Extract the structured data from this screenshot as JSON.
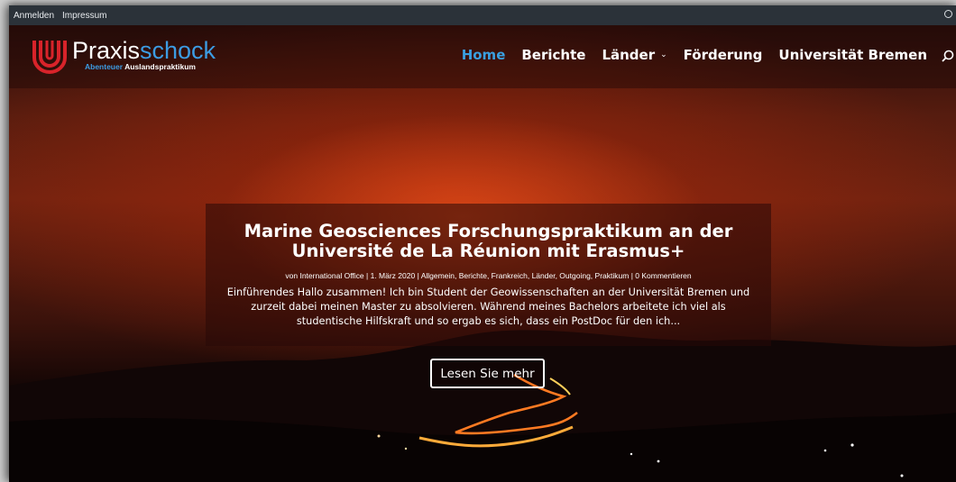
{
  "topbar": {
    "links": [
      "Anmelden",
      "Impressum"
    ]
  },
  "logo": {
    "word_part1": "Praxis",
    "word_part2": "schock",
    "tag_part1": "Abenteuer",
    "tag_part2": "Auslandspraktikum"
  },
  "nav": {
    "items": [
      {
        "label": "Home",
        "active": true
      },
      {
        "label": "Berichte"
      },
      {
        "label": "Länder",
        "has_dropdown": true
      },
      {
        "label": "Förderung"
      },
      {
        "label": "Universität Bremen"
      }
    ],
    "search_icon": "search-icon",
    "dropdown_icon": "chevron-down-icon"
  },
  "post": {
    "title": "Marine Geosciences Forschungspraktikum an der Université de La Réunion mit Erasmus+",
    "meta": {
      "prefix": "von",
      "author": "International Office",
      "date": "1. März 2020",
      "categories": [
        "Allgemein",
        "Berichte",
        "Frankreich",
        "Länder",
        "Outgoing",
        "Praktikum"
      ],
      "comments": "0 Kommentieren"
    },
    "excerpt": "Einführendes Hallo zusammen! Ich bin Student der Geowissenschaften an der Universität Bremen und zurzeit dabei meinen Master zu absolvieren. Während meines Bachelors arbeitete ich viel als studentische Hilfskraft und so ergab es sich, dass ein PostDoc für den ich...",
    "read_more": "Lesen Sie mehr"
  },
  "colors": {
    "accent": "#3a9fe0",
    "logo_red": "#d8232a",
    "topbar": "#2b3239"
  }
}
